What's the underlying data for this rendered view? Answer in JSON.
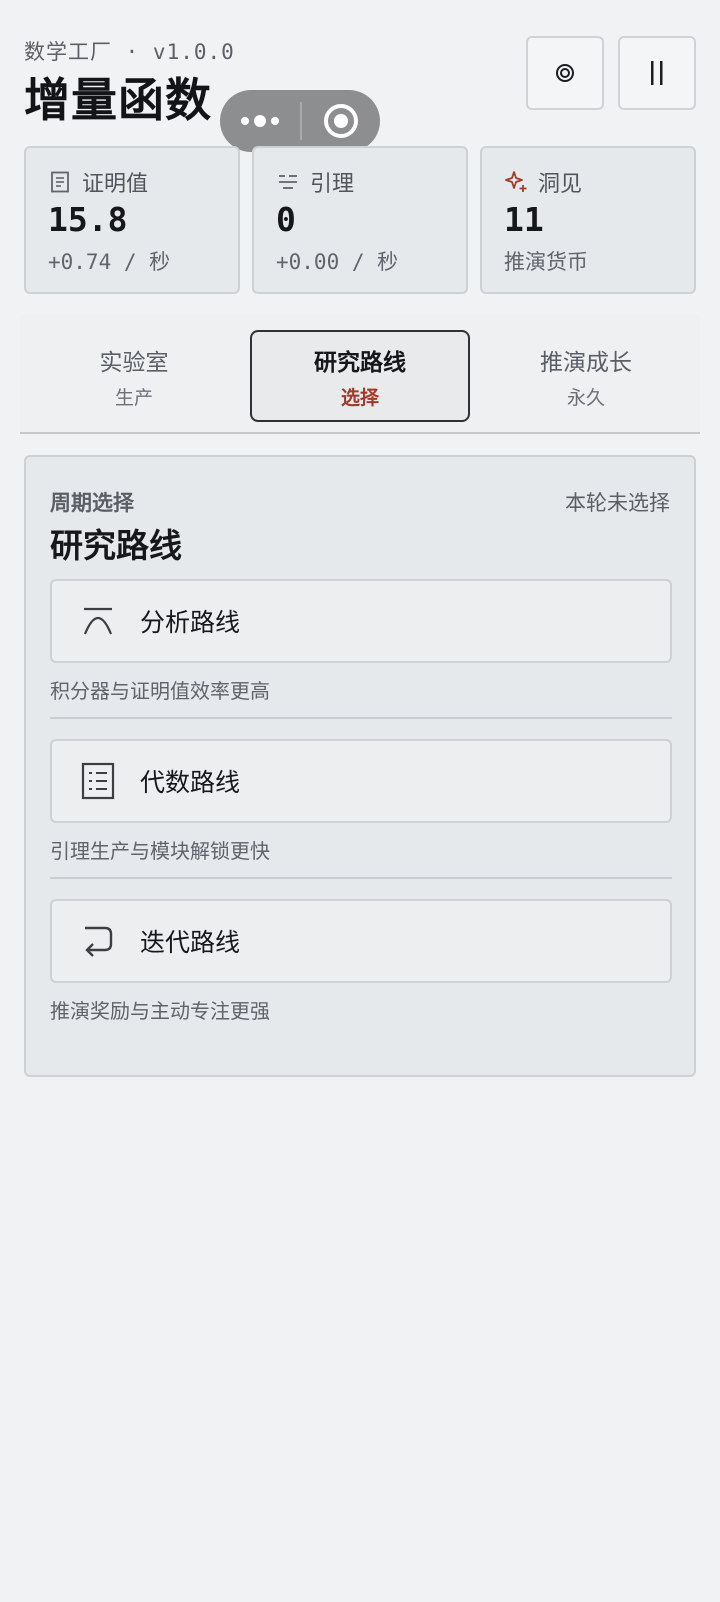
{
  "header": {
    "subtitle": "数学工厂 · v1.0.0",
    "title": "增量函数",
    "target_icon": "target-icon",
    "pause_icon": "pause-icon"
  },
  "stats": [
    {
      "icon": "document-icon",
      "label": "证明值",
      "value": "15.8",
      "sub": "+0.74 / 秒"
    },
    {
      "icon": "lines-icon",
      "label": "引理",
      "value": "0",
      "sub": "+0.00 / 秒"
    },
    {
      "icon": "sparkle-icon",
      "label": "洞见",
      "value": "11",
      "sub": "推演货币"
    }
  ],
  "tabs": [
    {
      "label": "实验室",
      "sub": "生产"
    },
    {
      "label": "研究路线",
      "sub": "选择"
    },
    {
      "label": "推演成长",
      "sub": "永久"
    }
  ],
  "panel": {
    "kicker": "周期选择",
    "title": "研究路线",
    "status": "本轮未选择",
    "routes": [
      {
        "icon": "curve-icon",
        "label": "分析路线",
        "desc": "积分器与证明值效率更高"
      },
      {
        "icon": "calculator-icon",
        "label": "代数路线",
        "desc": "引理生产与模块解锁更快"
      },
      {
        "icon": "return-arrow-icon",
        "label": "迭代路线",
        "desc": "推演奖励与主动专注更强"
      }
    ]
  },
  "colors": {
    "accent_red": "#a23a2a",
    "background": "#f1f2f4",
    "card": "#e6e9ec"
  }
}
